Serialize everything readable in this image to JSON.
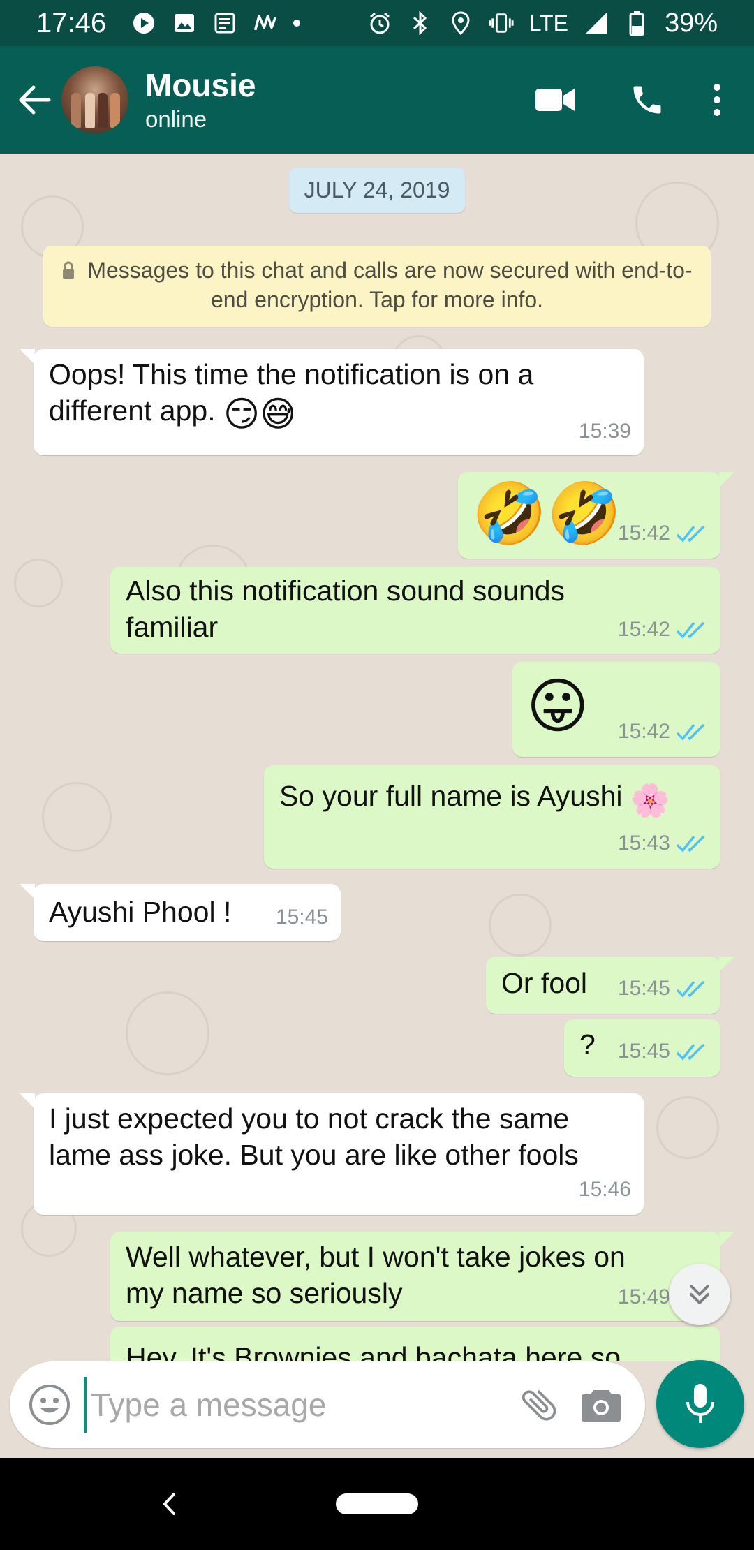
{
  "status_bar": {
    "time": "17:46",
    "network": "LTE",
    "battery": "39%"
  },
  "header": {
    "contact_name": "Mousie",
    "contact_status": "online"
  },
  "chat": {
    "date_chip": "JULY 24, 2019",
    "encryption_notice": "Messages to this chat and calls are now secured with end-to-end encryption. Tap for more info.",
    "messages": [
      {
        "direction": "in",
        "text": "Oops! This time the notification is on a\ndifferent app.",
        "emoji": "😏😅",
        "time": "15:39"
      },
      {
        "direction": "out",
        "text": "",
        "emoji": "🤣🤣",
        "time": "15:42",
        "read": true
      },
      {
        "direction": "out",
        "text": "Also this notification sound sounds\nfamiliar",
        "time": "15:42",
        "read": true
      },
      {
        "direction": "out",
        "text": "",
        "emoji": "😛",
        "time": "15:42",
        "read": true
      },
      {
        "direction": "out",
        "text": "So your full name is Ayushi",
        "emoji": "🌸",
        "time": "15:43",
        "read": true
      },
      {
        "direction": "in",
        "text": "Ayushi Phool !",
        "time": "15:45"
      },
      {
        "direction": "out",
        "text": "Or fool",
        "time": "15:45",
        "read": true
      },
      {
        "direction": "out",
        "text": "?",
        "time": "15:45",
        "read": true
      },
      {
        "direction": "in",
        "text": "I just expected you to not crack the same\nlame ass joke. But you are like other fools",
        "time": "15:46"
      },
      {
        "direction": "out",
        "text": "Well whatever, but I won't take jokes on\nmy name so seriously",
        "time": "15:49",
        "read": true
      },
      {
        "direction": "out",
        "text": "Hey, It's Brownies and bachata here so",
        "time": "",
        "read": true
      }
    ]
  },
  "composer": {
    "placeholder": "Type a message"
  },
  "colors": {
    "header": "#075e54",
    "status_bar": "#0a4d45",
    "outgoing_bubble": "#dcf8c6",
    "incoming_bubble": "#ffffff",
    "read_ticks": "#4fc3f7",
    "mic_button": "#00897b"
  },
  "icons": {
    "status_left": [
      "play-icon",
      "image-icon",
      "news-icon",
      "nyt-icon"
    ],
    "status_right": [
      "alarm-icon",
      "bluetooth-icon",
      "location-icon",
      "vibrate-icon",
      "signal-icon",
      "battery-icon"
    ],
    "header": [
      "back-arrow-icon",
      "video-call-icon",
      "phone-icon",
      "more-vert-icon"
    ],
    "composer": [
      "emoji-icon",
      "attach-icon",
      "camera-icon",
      "mic-icon"
    ]
  }
}
